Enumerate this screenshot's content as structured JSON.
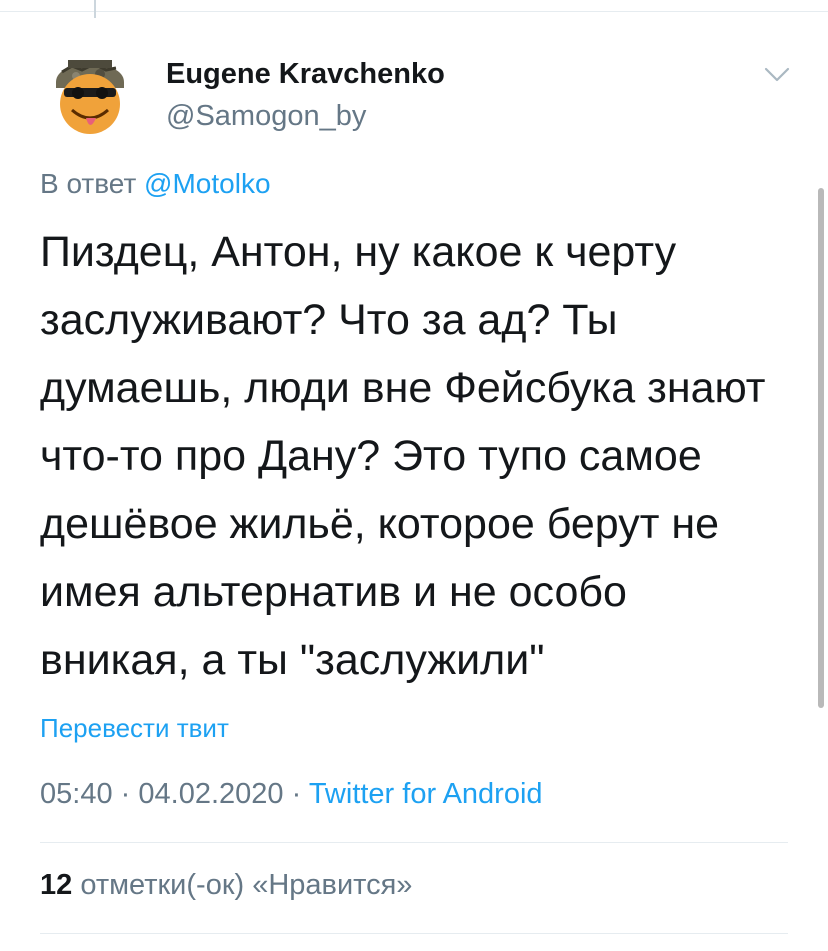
{
  "author": {
    "name": "Eugene Kravchenko",
    "handle": "@Samogon_by"
  },
  "reply": {
    "prefix": "В ответ",
    "mention": "@Motolko"
  },
  "tweet": {
    "text": "Пиздец, Антон, ну какое к черту\nзаслуживают? Что за ад? Ты\nдумаешь, люди вне Фейсбука знают\nчто-то про Дану? Это тупо самое\nдешёвое жильё, которое берут не\nимея альтернатив и не особо\nвникая, а ты \"заслужили\""
  },
  "translate_label": "Перевести твит",
  "meta": {
    "time": "05:40",
    "separator": "·",
    "date": "04.02.2020",
    "source": "Twitter for Android"
  },
  "likes": {
    "count": "12",
    "label": "отметки(-ок) «Нравится»"
  },
  "colors": {
    "accent": "#1da1f2",
    "secondary_text": "#657786",
    "primary_text": "#14171a"
  },
  "icons": {
    "menu": "chevron-down-icon",
    "avatar": "smiley-soldier-avatar"
  }
}
